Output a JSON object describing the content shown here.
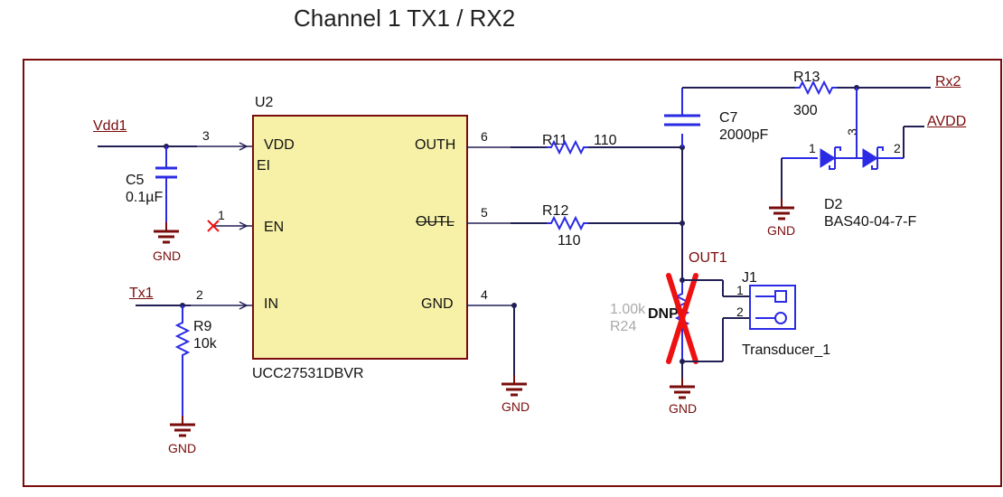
{
  "title": "Channel 1 TX1 / RX2",
  "chip": {
    "ref": "U2",
    "part": "UCC27531DBVR",
    "pins": {
      "vdd": {
        "name": "VDD",
        "num": "3"
      },
      "en": {
        "name": "EN",
        "num": "1"
      },
      "in": {
        "name": "IN",
        "num": "2"
      },
      "outh": {
        "name": "OUTH",
        "num": "6"
      },
      "outl": {
        "name": "OUTL",
        "num": "5"
      },
      "gnd": {
        "name": "GND",
        "num": "4"
      }
    },
    "ei_label": "EI"
  },
  "nets": {
    "vdd1": "Vdd1",
    "tx1": "Tx1",
    "rx2": "Rx2",
    "avdd": "AVDD",
    "out1": "OUT1",
    "gnd": "GND"
  },
  "parts": {
    "c5": {
      "ref": "C5",
      "val": "0.1µF"
    },
    "r9": {
      "ref": "R9",
      "val": "10k"
    },
    "r11": {
      "ref": "R11",
      "val": "110"
    },
    "r12": {
      "ref": "R12",
      "val": "110"
    },
    "r13": {
      "ref": "R13",
      "val": "300"
    },
    "c7": {
      "ref": "C7",
      "val": "2000pF"
    },
    "r24": {
      "ref": "R24",
      "val": "1.00k",
      "dnp": "DNP"
    },
    "d2": {
      "ref": "D2",
      "val": "BAS40-04-7-F",
      "p1": "1",
      "p2": "2",
      "p3": "3"
    },
    "j1": {
      "ref": "J1",
      "val": "Transducer_1",
      "p1": "1",
      "p2": "2"
    }
  }
}
